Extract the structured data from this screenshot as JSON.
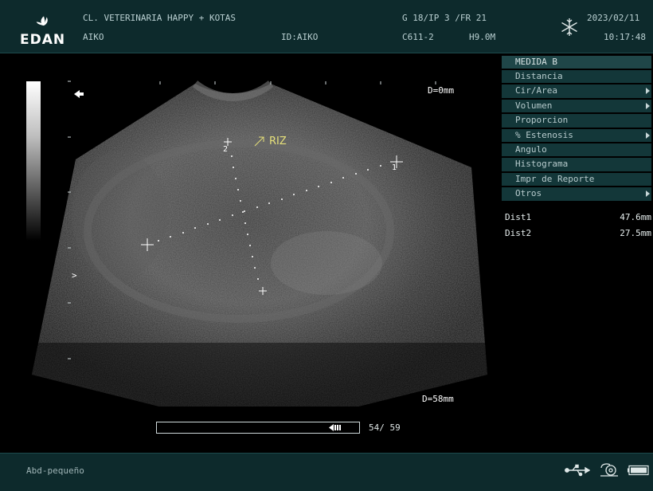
{
  "header": {
    "brand": "EDAN",
    "clinic_name": "CL. VETERINARIA HAPPY + KOTAS",
    "patient_name": "AIKO",
    "patient_id": "ID:AIKO",
    "params": "G 18/IP 3 /FR 21",
    "probe": "C611-2",
    "frequency": "H9.0M",
    "date": "2023/02/11",
    "time": "10:17:48",
    "freeze_icon": "snowflake-icon"
  },
  "image": {
    "depth_top": "D=0mm",
    "depth_bottom": "D=58mm",
    "annotation": "RIZ",
    "caliper1_label": "1",
    "caliper2_label": "2",
    "focus_marker": ">"
  },
  "menu": {
    "title": "MEDIDA B",
    "items": [
      {
        "label": "Distancia",
        "submenu": false
      },
      {
        "label": "Cir/Area",
        "submenu": true
      },
      {
        "label": "Volumen",
        "submenu": true
      },
      {
        "label": "Proporcion",
        "submenu": false
      },
      {
        "label": "% Estenosis",
        "submenu": true
      },
      {
        "label": "Angulo",
        "submenu": false
      },
      {
        "label": "Histograma",
        "submenu": false
      },
      {
        "label": "Impr de Reporte",
        "submenu": false
      },
      {
        "label": "Otros",
        "submenu": true
      }
    ]
  },
  "results": [
    {
      "label": "Dist1",
      "value": "47.6mm"
    },
    {
      "label": "Dist2",
      "value": "27.5mm"
    }
  ],
  "cine": {
    "current": 54,
    "total": 59,
    "counter_text": "54/ 59"
  },
  "footer": {
    "preset": "Abd-pequeño",
    "icons": [
      "usb-icon",
      "printer-icon",
      "battery-icon"
    ]
  },
  "colors": {
    "panel": "#0d2a2c",
    "menu_item": "#133739",
    "annotation": "#e6e07a"
  }
}
